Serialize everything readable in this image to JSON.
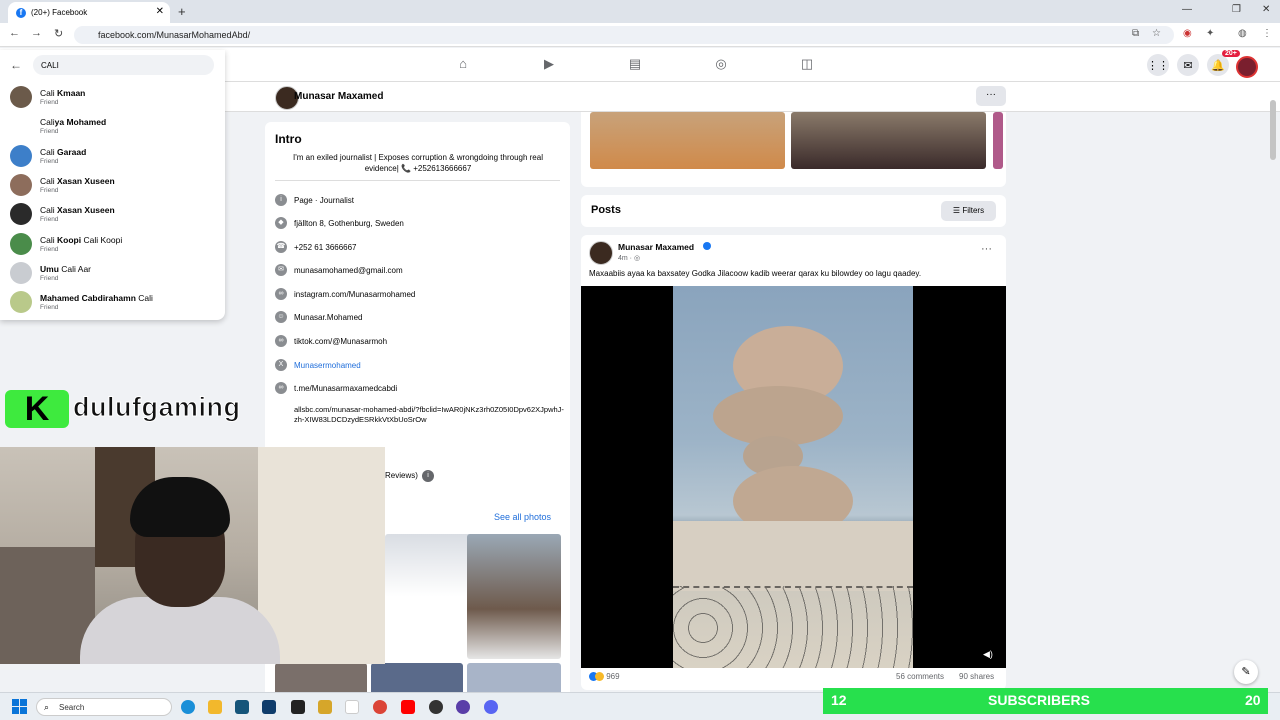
{
  "browser": {
    "tab_title": "(20+) Facebook",
    "url": "facebook.com/MunasarMohamedAbd/"
  },
  "fb_header": {
    "notification_badge": "20+"
  },
  "search": {
    "value": "CALI",
    "results": [
      {
        "pre": "Cali",
        "bold": " Kmaan",
        "post": "",
        "sub": "Friend",
        "color": "#6b5a4a"
      },
      {
        "pre": "Cali",
        "bold": "ya Mohamed",
        "post": "",
        "sub": "Friend",
        "color": "#ffffff"
      },
      {
        "pre": "Cali",
        "bold": " Garaad",
        "post": "",
        "sub": "Friend",
        "color": "#3d7fc9"
      },
      {
        "pre": "Cali",
        "bold": " Xasan Xuseen",
        "post": "",
        "sub": "Friend",
        "color": "#8d6d5c"
      },
      {
        "pre": "Cali",
        "bold": " Xasan Xuseen",
        "post": "",
        "sub": "Friend",
        "color": "#2a2a2a"
      },
      {
        "pre": "Cali",
        "bold": " Koopi",
        "post": " Cali Koopi",
        "sub": "Friend",
        "color": "#4a8c4a"
      },
      {
        "pre": "",
        "bold": "Umu ",
        "post": "Cali Aar",
        "sub": "Friend",
        "color": "#c9ccd1"
      },
      {
        "pre": "",
        "bold": "Mahamed Cabdirahamn ",
        "post": "Cali",
        "sub": "Friend",
        "color": "#b9c98a"
      }
    ]
  },
  "profile": {
    "name": "Munasar Maxamed",
    "more": "···"
  },
  "intro": {
    "title": "Intro",
    "bio": "I'm an exiled journalist | Exposes corruption & wrongdoing through real evidence| 📞 +252613666667",
    "rows": [
      {
        "icon": "i",
        "text": "Page · Journalist",
        "blue": false
      },
      {
        "icon": "◆",
        "text": "fjällton 8, Gothenburg, Sweden",
        "blue": false
      },
      {
        "icon": "☎",
        "text": "+252 61 3666667",
        "blue": false
      },
      {
        "icon": "✉",
        "text": "munasamohamed@gmail.com",
        "blue": false
      },
      {
        "icon": "∞",
        "text": "instagram.com/Munasarmohamed",
        "blue": false
      },
      {
        "icon": "☺",
        "text": "Munasar.Mohamed",
        "blue": false
      },
      {
        "icon": "∞",
        "text": "tiktok.com/@Munasarmoh",
        "blue": false
      },
      {
        "icon": "X",
        "text": "Munasermohamed",
        "blue": true
      },
      {
        "icon": "∞",
        "text": "t.me/Munasarmaxamedcabdi",
        "blue": false
      }
    ],
    "long_link": "allsbc.com/munasar-mohamed-abdi/?fbclid=IwAR0jNKz3rh0Z05I0Dpv62XJpwhJ-zh-XIW83LDCDzydESRkkVtXbUoSrOw",
    "reviews": "Reviews)",
    "see_all_photos": "See all photos"
  },
  "overlay": {
    "logo_letter": "K",
    "stream_name": "dulufgaming"
  },
  "posts": {
    "title": "Posts",
    "filters": "Filters",
    "author": "Munasar Maxamed",
    "time": "4m · ◎",
    "caption": "Maxaabiis ayaa ka baxsatey Godka Jilacoow kadib weerar qarax ku bilowdey oo lagu qaadey.",
    "reactions_count": "969",
    "comments": "56 comments",
    "shares": "90 shares"
  },
  "taskbar": {
    "search_placeholder": "Search"
  },
  "subscribers": {
    "count": "12",
    "label": "SUBSCRIBERS",
    "goal": "20"
  }
}
